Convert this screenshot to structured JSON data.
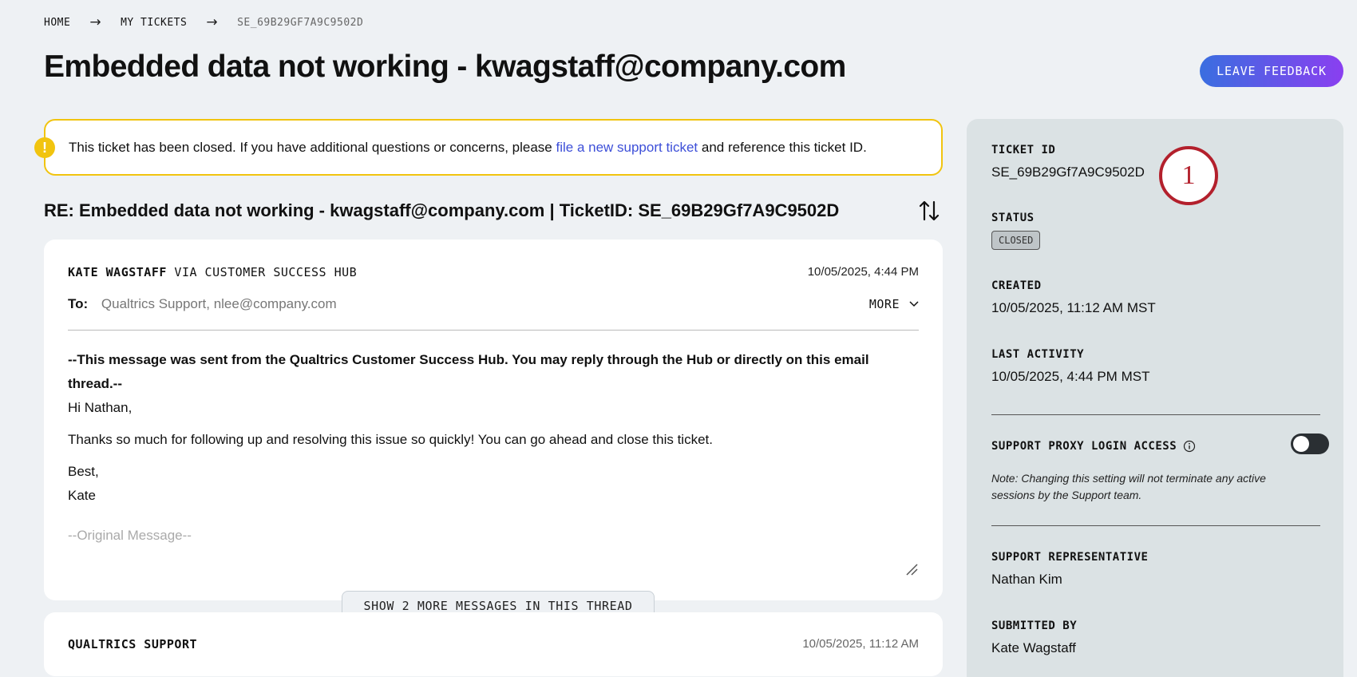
{
  "breadcrumb": {
    "home": "HOME",
    "my_tickets": "MY TICKETS",
    "current": "SE_69B29GF7A9C9502D"
  },
  "header": {
    "title": "Embedded data not working - kwagstaff@company.com",
    "feedback_label": "LEAVE FEEDBACK"
  },
  "alert": {
    "text_before": "This ticket has been closed. If you have additional questions or concerns, please ",
    "link_text": "file a new support ticket",
    "text_after": " and reference this ticket ID.",
    "icon": "!"
  },
  "thread": {
    "title": "RE: Embedded data not working - kwagstaff@company.com | TicketID: SE_69B29Gf7A9C9502D",
    "messages": [
      {
        "sender": "KATE WAGSTAFF",
        "via": " VIA CUSTOMER SUCCESS HUB",
        "timestamp": "10/05/2025, 4:44 PM",
        "to_label": "To:",
        "to": "Qualtrics Support, nlee@company.com",
        "more": "MORE",
        "body_bold": "--This message was sent from the Qualtrics Customer Success Hub. You may reply through the Hub or directly on this email thread.--",
        "greeting": "Hi Nathan,",
        "paragraph": "Thanks so much for following up and resolving this issue so quickly! You can go ahead and close this ticket.",
        "signoff": "Best,",
        "signature": "Kate",
        "original": "--Original Message--"
      },
      {
        "sender": "QUALTRICS SUPPORT",
        "timestamp": "10/05/2025, 11:12 AM"
      }
    ],
    "show_more": "SHOW 2 MORE MESSAGES IN THIS THREAD"
  },
  "sidebar": {
    "ticket_id_label": "TICKET ID",
    "ticket_id": "SE_69B29Gf7A9C9502D",
    "callout": "1",
    "status_label": "STATUS",
    "status": "CLOSED",
    "created_label": "CREATED",
    "created": "10/05/2025, 11:12 AM MST",
    "last_activity_label": "LAST ACTIVITY",
    "last_activity": "10/05/2025, 4:44 PM MST",
    "proxy_label": "SUPPORT PROXY LOGIN ACCESS",
    "proxy_note": "Note: Changing this setting will not terminate any active sessions by the Support team.",
    "rep_label": "SUPPORT REPRESENTATIVE",
    "rep": "Nathan Kim",
    "submitted_label": "SUBMITTED BY",
    "submitted": "Kate Wagstaff"
  },
  "colors": {
    "background": "#eef1f4",
    "alert_border": "#f1c40f",
    "link": "#3d4fd8",
    "callout": "#b3202c",
    "button_gradient_start": "#3a6ee0",
    "button_gradient_end": "#8a3ff0"
  }
}
